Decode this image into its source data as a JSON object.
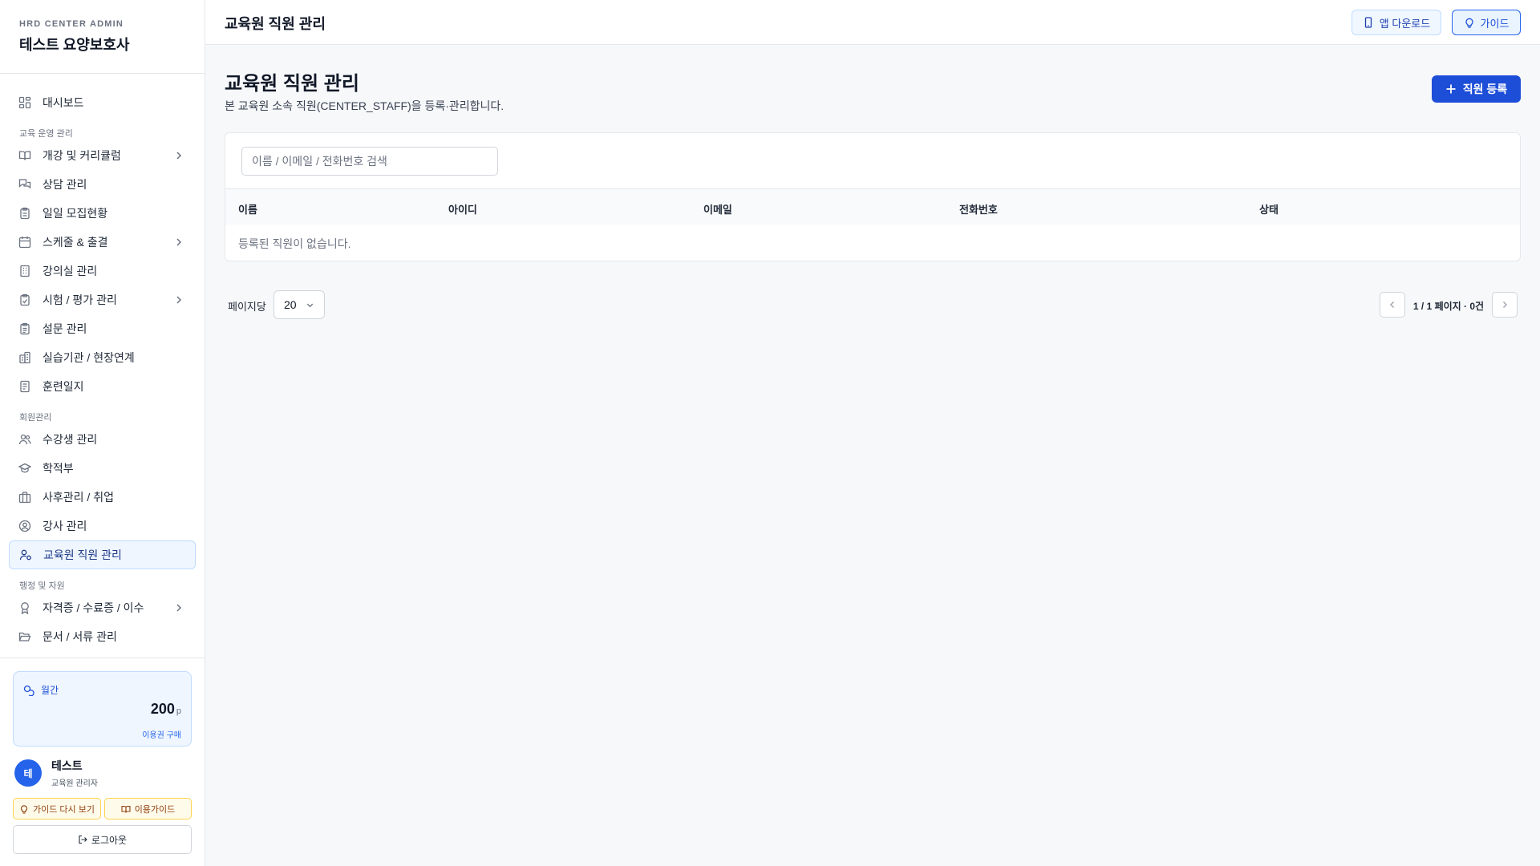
{
  "sidebar": {
    "eyebrow": "HRD CENTER ADMIN",
    "title": "테스트 요양보호사",
    "dashboard": "대시보드",
    "section_ops": "교육 운영 관리",
    "curriculum": "개강 및 커리큘럼",
    "counsel": "상담 관리",
    "recruit": "일일 모집현황",
    "schedule": "스케줄 & 출결",
    "classroom": "강의실 관리",
    "exam": "시험 / 평가 관리",
    "survey": "설문 관리",
    "practice": "실습기관 / 현장연계",
    "journal": "훈련일지",
    "section_members": "회원관리",
    "students": "수강생 관리",
    "registry": "학적부",
    "aftercare": "사후관리 / 취업",
    "instructors": "강사 관리",
    "staff": "교육원 직원 관리",
    "section_admin": "행정 및 자원",
    "certificates": "자격증 / 수료증 / 이수",
    "documents": "문서 / 서류 관리"
  },
  "plan": {
    "label": "월간",
    "amount": "200",
    "unit": "p",
    "buy": "이용권 구매"
  },
  "user": {
    "initial": "테",
    "name": "테스트",
    "role": "교육원 관리자"
  },
  "side_buttons": {
    "guide_again": "가이드 다시 보기",
    "usage_guide": "이용가이드",
    "logout": "로그아웃"
  },
  "topbar": {
    "title": "교육원 직원 관리",
    "app_download": "앱 다운로드",
    "guide": "가이드"
  },
  "page": {
    "heading": "교육원 직원 관리",
    "description": "본 교육원 소속 직원(CENTER_STAFF)을 등록·관리합니다.",
    "add_button": "직원 등록"
  },
  "search": {
    "placeholder": "이름 / 이메일 / 전화번호 검색",
    "value": ""
  },
  "table": {
    "columns": [
      "이름",
      "아이디",
      "이메일",
      "전화번호",
      "상태"
    ],
    "empty": "등록된 직원이 없습니다."
  },
  "pagination": {
    "per_page_label": "페이지당",
    "per_page_value": "20",
    "info": "1 / 1 페이지 · 0건"
  },
  "colors": {
    "accent": "#1d4ed8",
    "active_bg": "#eff6ff",
    "warn_bg": "#fffbeb"
  }
}
